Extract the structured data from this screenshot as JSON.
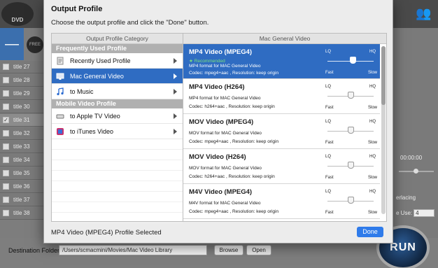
{
  "background": {
    "logo_label": "DVD",
    "titles": [
      {
        "label": "title 27",
        "checked": false
      },
      {
        "label": "title 28",
        "checked": false
      },
      {
        "label": "title 29",
        "checked": false
      },
      {
        "label": "title 30",
        "checked": false
      },
      {
        "label": "title 31",
        "checked": true
      },
      {
        "label": "title 32",
        "checked": false
      },
      {
        "label": "title 33",
        "checked": false
      },
      {
        "label": "title 34",
        "checked": false
      },
      {
        "label": "title 35",
        "checked": false
      },
      {
        "label": "title 36",
        "checked": false
      },
      {
        "label": "title 37",
        "checked": false
      },
      {
        "label": "title 38",
        "checked": false
      }
    ],
    "time": "00:00:00",
    "interlacing": "erlacing",
    "use_label": "e Use:",
    "use_value": "4",
    "destination_label": "Destination Folder:",
    "destination_path": "/Users/scmacmini/Movies/Mac Video Library",
    "browse_label": "Browse",
    "open_label": "Open",
    "run_label": "RUN"
  },
  "dialog": {
    "title": "Output Profile",
    "instruction": "Choose the output profile and click the \"Done\" button.",
    "category_header": "Output Profile Category",
    "profile_header": "Mac General Video",
    "sections": [
      {
        "label": "Frequently Used Profile"
      },
      {
        "label": "Mobile Video Profile"
      }
    ],
    "categories_frequent": [
      {
        "label": "Recently Used Profile",
        "icon": "profile-icon",
        "selected": false,
        "has_arrow": true
      },
      {
        "label": "Mac General Video",
        "icon": "mac-icon",
        "selected": true,
        "has_arrow": true
      },
      {
        "label": "to Music",
        "icon": "music-note-icon",
        "selected": false,
        "has_arrow": true
      }
    ],
    "categories_mobile": [
      {
        "label": "to Apple TV Video",
        "icon": "apple-tv-icon",
        "selected": false,
        "has_arrow": true
      },
      {
        "label": "to iTunes Video",
        "icon": "itunes-icon",
        "selected": false,
        "has_arrow": true
      }
    ],
    "profiles": [
      {
        "name": "MP4 Video (MPEG4)",
        "recommended": "★ Recommended",
        "description": "MP4 format for MAC General Video",
        "codec": "Codec: mpeg4+aac , Resolution: keep origin",
        "selected": true,
        "quality": 0.55
      },
      {
        "name": "MP4 Video (H264)",
        "recommended": "",
        "description": "MP4 format for MAC General Video",
        "codec": "Codec: h264+aac , Resolution: keep origin",
        "selected": false,
        "quality": 0.5
      },
      {
        "name": "MOV Video (MPEG4)",
        "recommended": "",
        "description": "MOV format for MAC General Video",
        "codec": "Codec: mpeg4+aac , Resolution: keep origin",
        "selected": false,
        "quality": 0.5
      },
      {
        "name": "MOV Video (H264)",
        "recommended": "",
        "description": "MOV format for MAC General Video",
        "codec": "Codec: h264+aac , Resolution: keep origin",
        "selected": false,
        "quality": 0.5
      },
      {
        "name": "M4V Video (MPEG4)",
        "recommended": "",
        "description": "M4V format for MAC General Video",
        "codec": "Codec: mpeg4+aac , Resolution: keep origin",
        "selected": false,
        "quality": 0.5
      }
    ],
    "quality_labels": {
      "lq": "LQ",
      "hq": "HQ",
      "fast": "Fast",
      "slow": "Slow"
    },
    "status": "MP4 Video (MPEG4) Profile Selected",
    "done_label": "Done"
  },
  "colors": {
    "selection": "#2f6cc2",
    "done_button": "#2f7bea",
    "recommended": "#7be07b"
  }
}
